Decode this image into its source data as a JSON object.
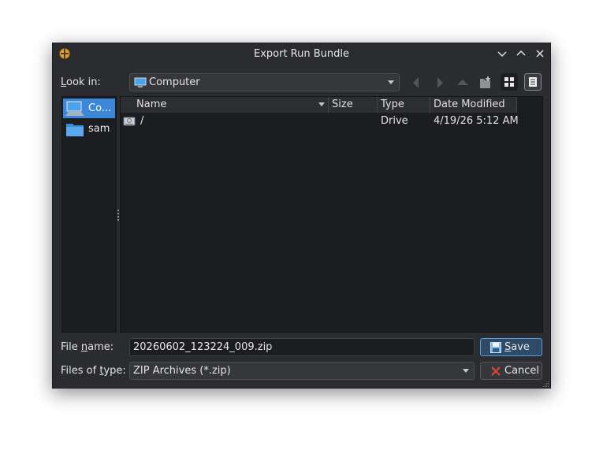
{
  "window": {
    "title": "Export Run Bundle"
  },
  "look_in": {
    "label_prefix": "L",
    "label_rest": "ook in:",
    "value": "Computer"
  },
  "sidebar": {
    "items": [
      {
        "label": "Co..."
      },
      {
        "label": "sam"
      }
    ]
  },
  "columns": [
    "Name",
    "Size",
    "Type",
    "Date Modified"
  ],
  "files": [
    {
      "name": "/",
      "size": "",
      "type": "Drive",
      "date_modified": "4/19/26 5:12 AM"
    }
  ],
  "file_name": {
    "label_a": "File ",
    "label_u": "n",
    "label_b": "ame:",
    "value": "20260602_123224_009.zip"
  },
  "file_type": {
    "label_a": "Files of ",
    "label_u": "t",
    "label_b": "ype:",
    "value": "ZIP Archives (*.zip)"
  },
  "buttons": {
    "save": "Save",
    "save_underline": "S",
    "save_rest": "ave",
    "cancel": "Cancel"
  },
  "colors": {
    "accent": "#3b86d9",
    "background": "#2b2c30",
    "panel": "#1c1d20"
  }
}
